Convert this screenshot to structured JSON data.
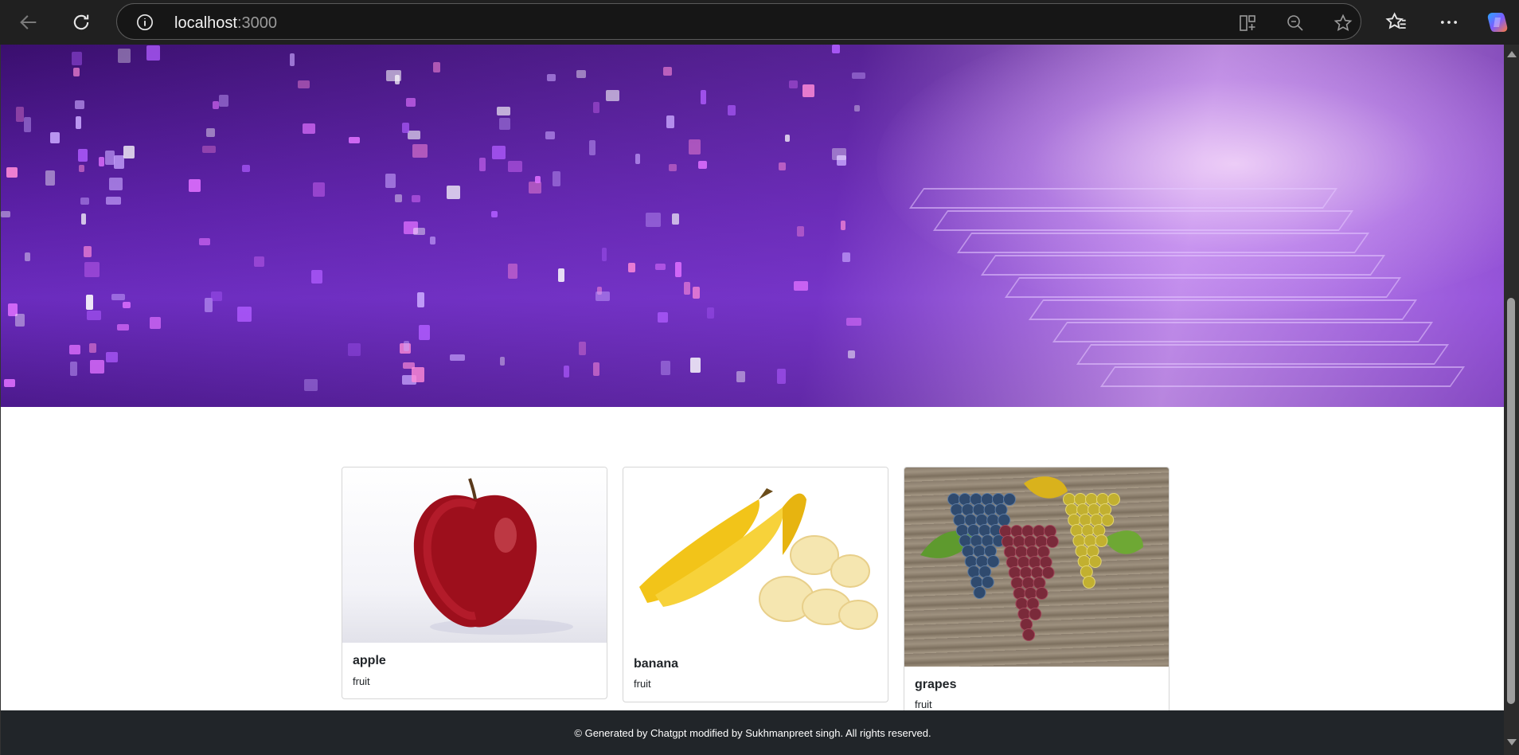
{
  "browser": {
    "url_host": "localhost",
    "url_port": ":3000",
    "icons": [
      "back-icon",
      "refresh-icon",
      "site-info-icon",
      "split-screen-icon",
      "zoom-out-icon",
      "favorite-star-icon",
      "favorites-icon",
      "more-icon",
      "copilot-icon"
    ]
  },
  "cards": [
    {
      "title": "apple",
      "text": "fruit",
      "image": "apple-image"
    },
    {
      "title": "banana",
      "text": "fruit",
      "image": "banana-image"
    },
    {
      "title": "grapes",
      "text": "fruit",
      "image": "grapes-image"
    }
  ],
  "footer": {
    "text": "© Generated by Chatgpt modified by Sukhmanpreet singh. All rights reserved."
  },
  "colors": {
    "chrome_bg": "#202020",
    "hero_purple": "#6a2bbd",
    "footer_bg": "#212529"
  }
}
